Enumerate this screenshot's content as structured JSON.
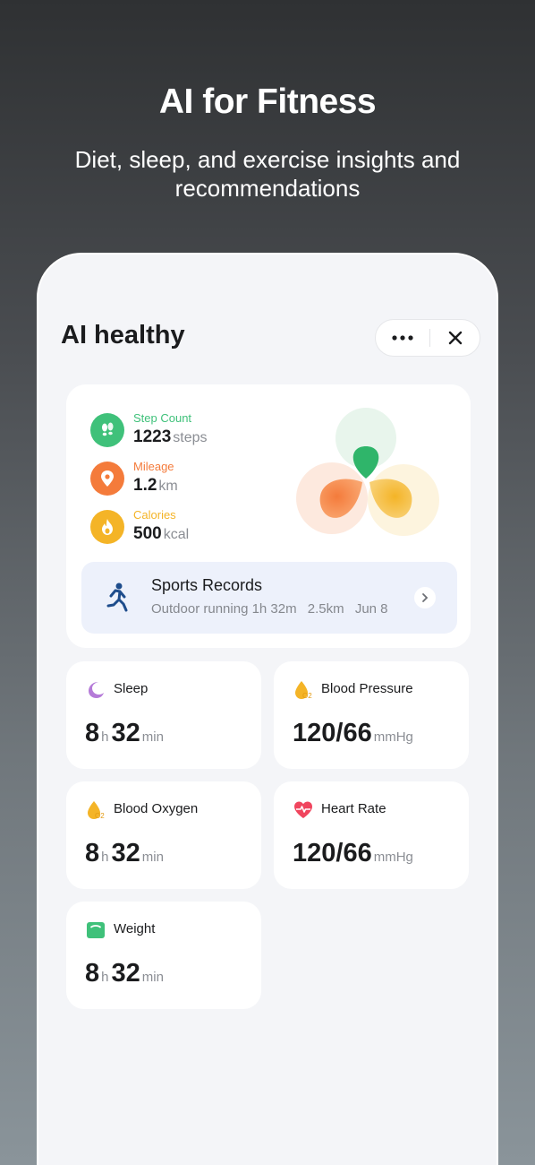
{
  "promo": {
    "title": "AI for Fitness",
    "subtitle": "Diet, sleep, and exercise insights and recommendations"
  },
  "app": {
    "title": "AI healthy",
    "capsule": {
      "more_icon": "more-icon",
      "close_icon": "close-icon"
    }
  },
  "summary": {
    "metrics": [
      {
        "label": "Step Count",
        "value": "1223",
        "unit": "steps",
        "color": "#3fc17a",
        "icon": "footprints-icon"
      },
      {
        "label": "Mileage",
        "value": "1.2",
        "unit": "km",
        "color": "#f47b3b",
        "icon": "location-pin-icon"
      },
      {
        "label": "Calories",
        "value": "500",
        "unit": "kcal",
        "color": "#f4b427",
        "icon": "flame-icon"
      }
    ],
    "sports": {
      "title": "Sports Records",
      "activity": "Outdoor running 1h 32m",
      "distance": "2.5km",
      "date": "Jun 8"
    }
  },
  "tiles": [
    {
      "name": "Sleep",
      "icon": "moon-icon",
      "color": "#b57bd8",
      "v1": "8",
      "u1": "h",
      "v2": "32",
      "u2": "min"
    },
    {
      "name": "Blood Pressure",
      "icon": "droplet-o2-icon",
      "color": "#f4b427",
      "v1": "120/66",
      "u1": "mmHg"
    },
    {
      "name": "Blood Oxygen",
      "icon": "droplet-o2-icon",
      "color": "#f4b427",
      "v1": "8",
      "u1": "h",
      "v2": "32",
      "u2": "min"
    },
    {
      "name": "Heart Rate",
      "icon": "heart-rate-icon",
      "color": "#f0455e",
      "v1": "120/66",
      "u1": "mmHg"
    },
    {
      "name": "Weight",
      "icon": "scale-icon",
      "color": "#3fc17a",
      "v1": "8",
      "u1": "h",
      "v2": "32",
      "u2": "min"
    }
  ],
  "badge_o2": "O2"
}
